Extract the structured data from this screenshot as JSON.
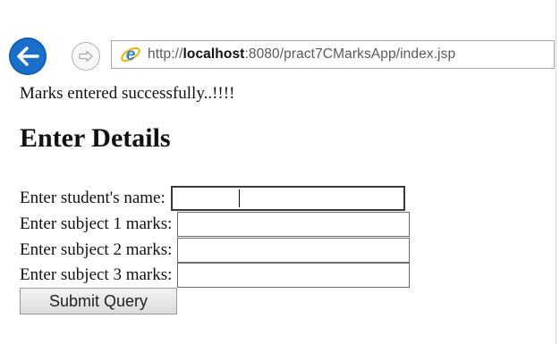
{
  "browser": {
    "url_prefix": "http://",
    "url_host": "localhost",
    "url_rest": ":8080/pract7CMarksApp/index.jsp",
    "back_icon": "back-arrow-icon",
    "forward_icon": "forward-arrow-icon",
    "page_icon": "internet-explorer-icon",
    "accent_color": "#1a6fc9"
  },
  "page": {
    "message": "Marks entered successfully..!!!!",
    "heading": "Enter Details"
  },
  "form": {
    "fields": [
      {
        "label": "Enter student's name:",
        "value": ""
      },
      {
        "label": "Enter subject 1 marks:",
        "value": ""
      },
      {
        "label": "Enter subject 2 marks:",
        "value": ""
      },
      {
        "label": "Enter subject 3 marks:",
        "value": ""
      }
    ],
    "submit_label": "Submit Query"
  }
}
